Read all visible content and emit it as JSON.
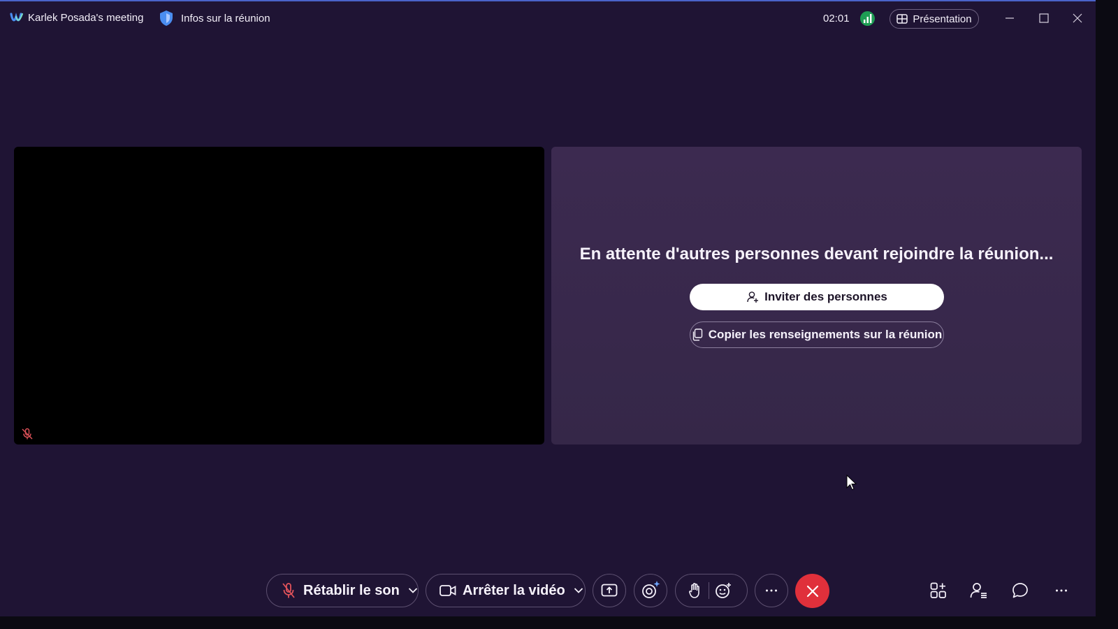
{
  "titlebar": {
    "meeting_title": "Karlek Posada's meeting",
    "meeting_info_label": "Infos sur la réunion",
    "timer": "02:01",
    "presentation_label": "Présentation",
    "icons": [
      "webex-logo-icon",
      "shield-icon",
      "network-status-icon",
      "layout-grid-icon",
      "minimize-icon",
      "maximize-icon",
      "close-icon"
    ]
  },
  "stage": {
    "self_view": {
      "muted_indicator": "mic-muted-icon"
    },
    "waiting_panel": {
      "message": "En attente d'autres personnes devant rejoindre la réunion...",
      "invite_label": "Inviter des personnes",
      "copy_label": "Copier les renseignements sur la réunion"
    }
  },
  "controls": {
    "unmute_label": "Rétablir le son",
    "stop_video_label": "Arrêter la vidéo",
    "buttons": [
      "share-screen",
      "ai-assistant",
      "raise-hand",
      "reactions",
      "more-options",
      "end-call"
    ],
    "side_buttons": [
      "apps",
      "participants",
      "chat",
      "more"
    ]
  },
  "colors": {
    "background": "#1f1434",
    "panel": "#3c2a50",
    "end_call": "#e0303b",
    "muted_red": "#e0525a",
    "network_green": "#1e9e54"
  }
}
